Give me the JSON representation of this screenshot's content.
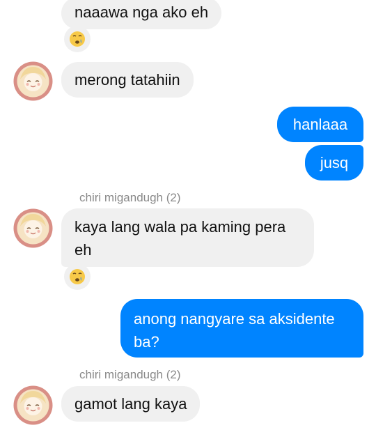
{
  "thread": {
    "messages": [
      {
        "id": "m1",
        "direction": "incoming",
        "text": "naaawa nga ako eh",
        "reaction": "crying-face"
      },
      {
        "id": "m2",
        "direction": "incoming",
        "text": "merong tatahiin"
      },
      {
        "id": "m3",
        "direction": "outgoing",
        "text": "hanlaaa"
      },
      {
        "id": "m4",
        "direction": "outgoing",
        "text": "jusq"
      },
      {
        "id": "m5",
        "direction": "incoming",
        "sender": "chiri migandugh (2)",
        "text": "kaya lang wala pa kaming pera\neh",
        "reaction": "crying-face"
      },
      {
        "id": "m6",
        "direction": "outgoing",
        "text": "anong nangyare sa aksidente\nba?"
      },
      {
        "id": "m7",
        "direction": "incoming",
        "sender": "chiri migandugh (2)",
        "text": "gamot lang kaya"
      }
    ]
  },
  "colors": {
    "incoming_bubble": "#f0f0f0",
    "outgoing_bubble": "#0084ff",
    "sender_name": "#8a8a8a"
  }
}
